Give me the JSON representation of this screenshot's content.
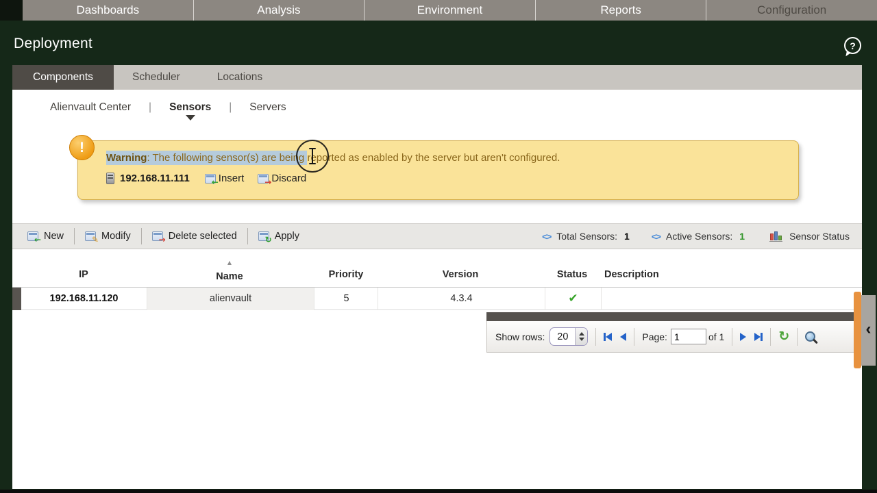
{
  "colors": {
    "brand_dark_green": "#152818",
    "nav_gray": "#8c8781",
    "tab_active_bg": "#4f4b46",
    "warning_bg": "#fae399",
    "warning_border": "#d6b04c",
    "selection_blue": "#b5cbdc",
    "accent_blue": "#2563c9",
    "success_green": "#39a52b",
    "handle_orange": "#e8923f"
  },
  "top_nav": {
    "items": [
      "Dashboards",
      "Analysis",
      "Environment",
      "Reports",
      "Configuration"
    ]
  },
  "header": {
    "title": "Deployment",
    "help_glyph": "?"
  },
  "tabs": {
    "items": [
      {
        "label": "Components",
        "active": true
      },
      {
        "label": "Scheduler",
        "active": false
      },
      {
        "label": "Locations",
        "active": false
      }
    ]
  },
  "subnav": {
    "separator": "|",
    "items": [
      "Alienvault Center",
      "Sensors",
      "Servers"
    ],
    "active": "Sensors"
  },
  "warning": {
    "icon_glyph": "!",
    "selected_bold": "Warning",
    "selected_text": ": The following sensor(s) are being ",
    "remaining_text": "reported as enabled by the server but aren't configured.",
    "sensor_ip": "192.168.11.111",
    "insert_label": "Insert",
    "insert_glyph": "←",
    "discard_label": "Discard",
    "discard_glyph": "→"
  },
  "toolbar": {
    "buttons": [
      {
        "label": "New",
        "glyph": "←"
      },
      {
        "label": "Modify",
        "glyph": "✎"
      },
      {
        "label": "Delete selected",
        "glyph": "→"
      },
      {
        "label": "Apply",
        "glyph": "↻"
      }
    ],
    "stats": {
      "diamond_glyph": "<>",
      "total_label": "Total Sensors:",
      "total_value": "1",
      "active_label": "Active Sensors:",
      "active_value": "1",
      "status_label": "Sensor Status"
    }
  },
  "table": {
    "columns": [
      "IP",
      "Name",
      "Priority",
      "Version",
      "Status",
      "Description"
    ],
    "sort": {
      "column": "Name",
      "direction": "asc",
      "glyph": "▲"
    },
    "rows": [
      {
        "ip": "192.168.11.120",
        "name": "alienvault",
        "priority": "5",
        "version": "4.3.4",
        "status_glyph": "✔",
        "description": ""
      }
    ]
  },
  "pagination": {
    "show_rows_label": "Show rows:",
    "rows_per_page": "20",
    "page_label": "Page:",
    "current_page": "1",
    "of_label": "of 1",
    "refresh_glyph": "↻"
  },
  "side_handle": {
    "chevron_glyph": "‹"
  }
}
